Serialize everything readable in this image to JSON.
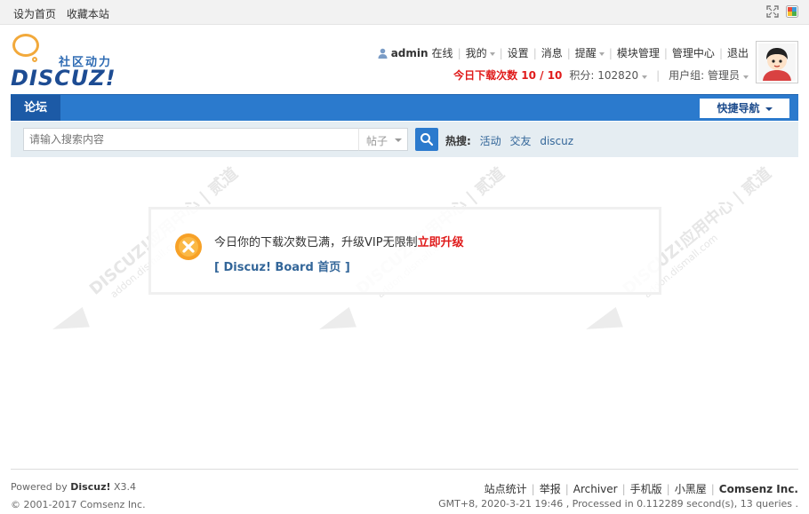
{
  "topbar": {
    "set_home": "设为首页",
    "bookmark": "收藏本站"
  },
  "logo": {
    "tagline": "社区动力",
    "wordmark": "DISCUZ!"
  },
  "user_menu": {
    "username": "admin",
    "online": "在线",
    "mine": "我的",
    "settings": "设置",
    "messages": "消息",
    "reminders": "提醒",
    "module_manage": "模块管理",
    "admin_center": "管理中心",
    "logout": "退出"
  },
  "credits": {
    "download_label": "今日下载次数 10 / 10",
    "points_label": "积分: 102820",
    "usergroup_label": "用户组: 管理员"
  },
  "nav": {
    "forum_tab": "论坛",
    "quick_nav": "快捷导航"
  },
  "search": {
    "placeholder": "请输入搜索内容",
    "type_value": "帖子",
    "hot_label": "热搜:",
    "hot_items": [
      "活动",
      "交友",
      "discuz"
    ]
  },
  "watermark": {
    "brand": "DISCUZ!应用中心",
    "mark": "贰道",
    "site": "addon.dismall.com"
  },
  "message": {
    "text": "今日你的下载次数已满，升级VIP无限制",
    "upgrade_link": "立即升级",
    "back_link": "[ Discuz! Board 首页 ]"
  },
  "footer": {
    "powered_prefix": "Powered by",
    "powered_brand": "Discuz!",
    "version": "X3.4",
    "copyright": "© 2001-2017 Comsenz Inc.",
    "links": [
      "站点统计",
      "举报",
      "Archiver",
      "手机版",
      "小黑屋"
    ],
    "company": "Comsenz Inc.",
    "debug": "GMT+8, 2020-3-21 19:46 , Processed in 0.112289 second(s), 13 queries ."
  },
  "colors": {
    "nav_blue": "#2b7acd",
    "alert_red": "#e01b1b",
    "link_blue": "#336699",
    "warn_orange": "#f7a127"
  }
}
